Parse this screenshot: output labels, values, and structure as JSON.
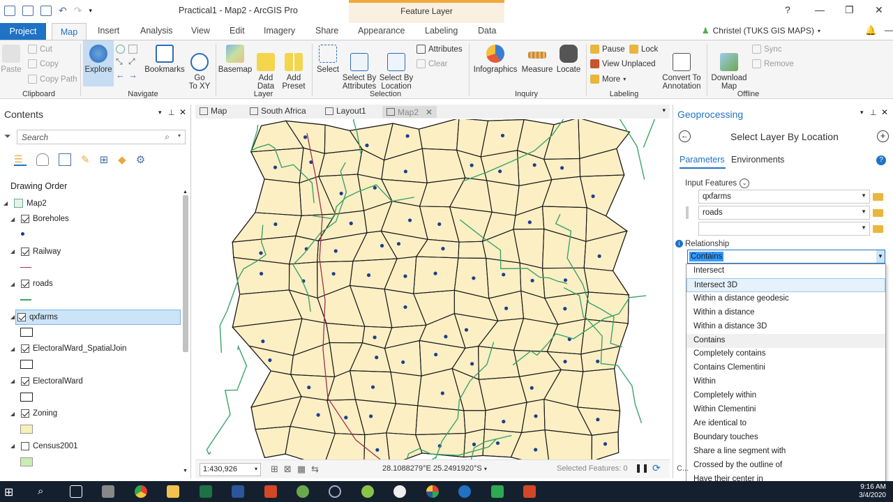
{
  "app": {
    "title": "Practical1 - Map2 - ArcGIS Pro",
    "context_tab": "Feature Layer",
    "help": "?",
    "user": "Christel (TUKS GIS MAPS)"
  },
  "ribbon_tabs": [
    "Project",
    "Map",
    "Insert",
    "Analysis",
    "View",
    "Edit",
    "Imagery",
    "Share",
    "Appearance",
    "Labeling",
    "Data"
  ],
  "ribbon": {
    "clipboard": {
      "paste": "Paste",
      "cut": "Cut",
      "copy": "Copy",
      "copy_path": "Copy Path",
      "group": "Clipboard"
    },
    "navigate": {
      "explore": "Explore",
      "bookmarks": "Bookmarks",
      "goto": "Go\nTo XY",
      "group": "Navigate"
    },
    "layer": {
      "basemap": "Basemap",
      "add_data": "Add\nData",
      "add_preset": "Add\nPreset",
      "group": "Layer"
    },
    "selection": {
      "select": "Select",
      "select_by_attr": "Select By\nAttributes",
      "select_by_loc": "Select By\nLocation",
      "attributes": "Attributes",
      "clear": "Clear",
      "group": "Selection"
    },
    "inquiry": {
      "infographics": "Infographics",
      "measure": "Measure",
      "locate": "Locate",
      "group": "Inquiry"
    },
    "labeling": {
      "pause": "Pause",
      "lock": "Lock",
      "view_unplaced": "View Unplaced",
      "more": "More",
      "convert": "Convert To\nAnnotation",
      "group": "Labeling"
    },
    "offline": {
      "download": "Download\nMap",
      "sync": "Sync",
      "remove": "Remove",
      "group": "Offline"
    }
  },
  "contents": {
    "title": "Contents",
    "search_placeholder": "Search",
    "drawing_order": "Drawing Order",
    "map_name": "Map2",
    "layers": [
      {
        "name": "Boreholes",
        "checked": true,
        "symbol": "point"
      },
      {
        "name": "Railway",
        "checked": true,
        "symbol": "line-red"
      },
      {
        "name": "roads",
        "checked": true,
        "symbol": "line-green"
      },
      {
        "name": "qxfarms",
        "checked": true,
        "symbol": "poly-empty",
        "selected": true
      },
      {
        "name": "ElectoralWard_SpatialJoin",
        "checked": true,
        "symbol": "poly-empty"
      },
      {
        "name": "ElectoralWard",
        "checked": true,
        "symbol": "poly-empty"
      },
      {
        "name": "Zoning",
        "checked": true,
        "symbol": "poly-yellow"
      },
      {
        "name": "Census2001",
        "checked": false,
        "symbol": "poly-green"
      }
    ]
  },
  "map_tabs": [
    "Map",
    "South Africa",
    "Layout1",
    "Map2"
  ],
  "map_status": {
    "scale": "1:430,926",
    "coords": "28.1088279°E 25.2491920°S",
    "selected": "Selected Features: 0"
  },
  "geoprocessing": {
    "title": "Geoprocessing",
    "tool": "Select Layer By Location",
    "tab_params": "Parameters",
    "tab_env": "Environments",
    "input_label": "Input Features",
    "inputs": [
      "qxfarms",
      "roads",
      ""
    ],
    "relationship_label": "Relationship",
    "relationship_value": "Contains",
    "options": [
      "Intersect",
      "Intersect 3D",
      "Within a distance geodesic",
      "Within a distance",
      "Within a distance 3D",
      "Contains",
      "Completely contains",
      "Contains Clementini",
      "Within",
      "Completely within",
      "Within Clementini",
      "Are identical to",
      "Boundary touches",
      "Share a line segment with",
      "Crossed by the outline of",
      "Have their center in"
    ],
    "hover_index": 1,
    "selected_index": 5
  },
  "taskbar": {
    "time": "9:16 AM",
    "date": "3/4/2020"
  },
  "colors": {
    "accent": "#1f72c4",
    "map_fill": "#fcefc4",
    "roads": "#3aa36a",
    "railway": "#a0304a",
    "boreholes": "#1d3f8c"
  }
}
